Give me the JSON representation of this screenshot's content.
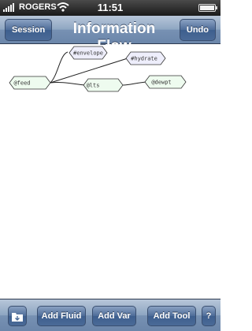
{
  "status_bar": {
    "carrier": "ROGERS",
    "time": "11:51"
  },
  "nav": {
    "title": "Information Flow",
    "left_button": "Session",
    "right_button": "Undo"
  },
  "graph": {
    "nodes": [
      {
        "id": "feed",
        "label": "@feed"
      },
      {
        "id": "envelope",
        "label": "#envelope"
      },
      {
        "id": "hydrate",
        "label": "#hydrate"
      },
      {
        "id": "lts",
        "label": "@lts"
      },
      {
        "id": "dewpt",
        "label": "@dewpt"
      }
    ],
    "edges": [
      [
        "feed",
        "envelope"
      ],
      [
        "feed",
        "hydrate"
      ],
      [
        "feed",
        "lts"
      ],
      [
        "lts",
        "dewpt"
      ]
    ],
    "colors": {
      "fluid_node_fill": "#eefbef",
      "tool_node_fill": "#eeeefb",
      "node_stroke": "#333333"
    }
  },
  "toolbar": {
    "folder_icon": "folder-icon",
    "add_fluid": "Add Fluid",
    "add_var": "Add Var",
    "add_tool": "Add Tool",
    "help": "?"
  }
}
